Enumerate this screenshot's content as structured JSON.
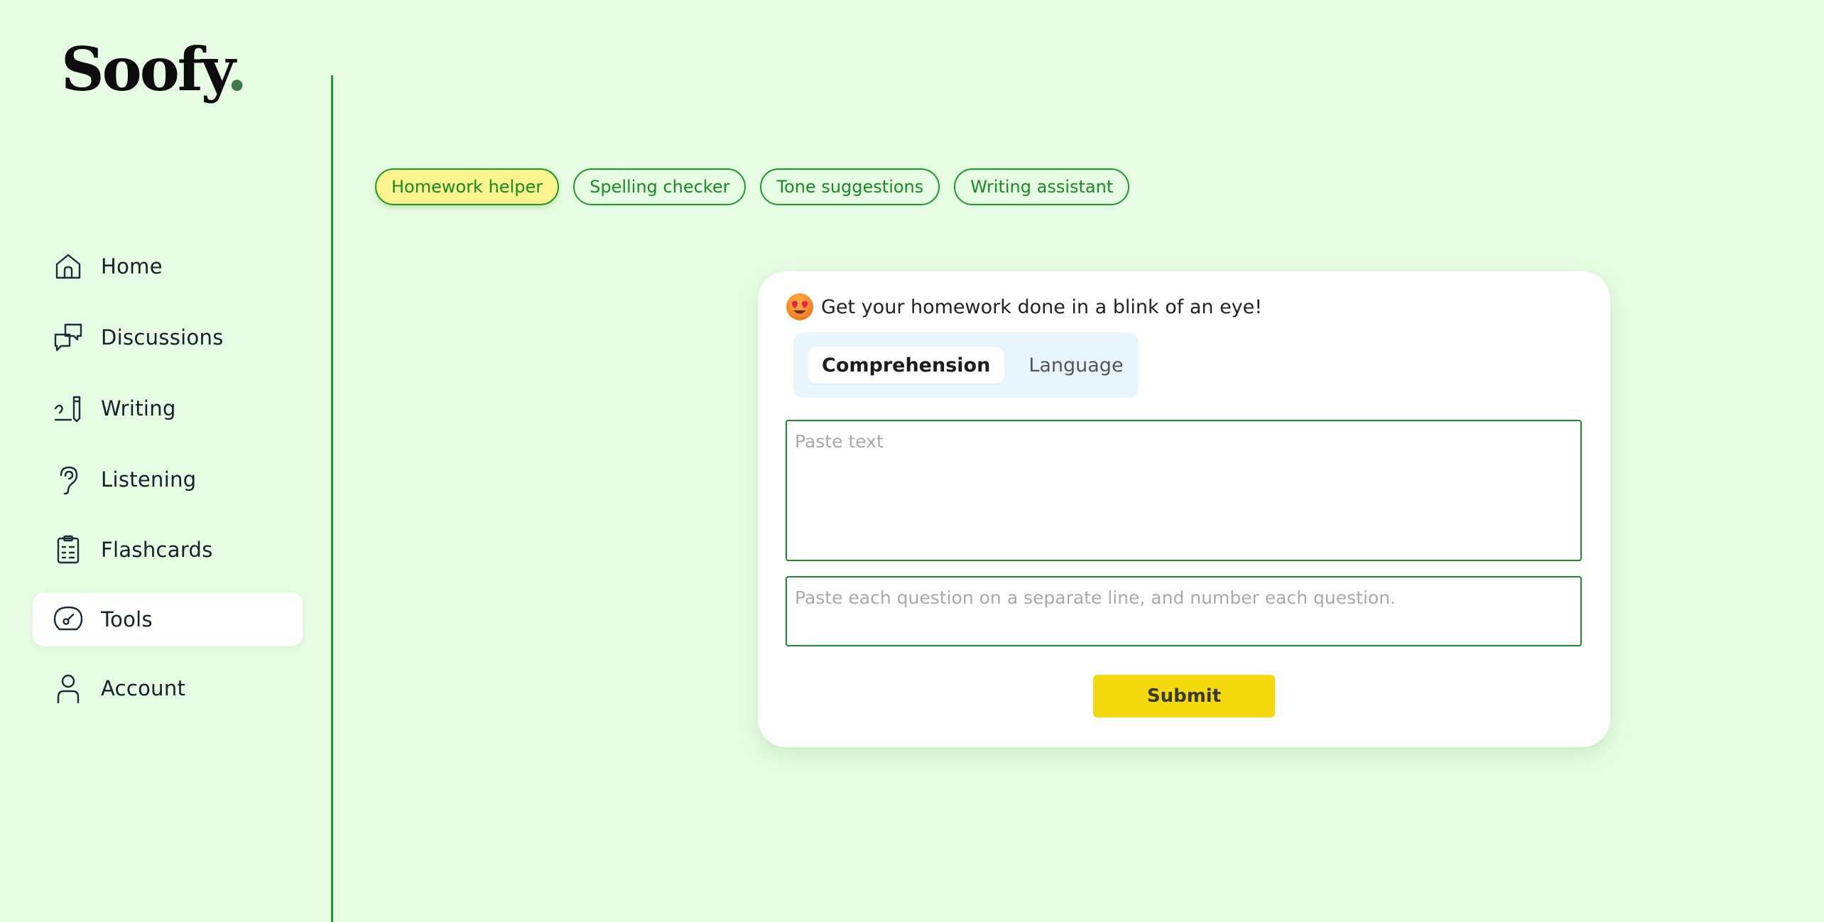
{
  "brand": {
    "name": "Soofy",
    "dot": ".",
    "dot_color": "#3f7a4f"
  },
  "sidebar": {
    "items": [
      {
        "label": "Home",
        "icon": "home-icon",
        "active": false
      },
      {
        "label": "Discussions",
        "icon": "chat-bubbles-icon",
        "active": false
      },
      {
        "label": "Writing",
        "icon": "pen-writing-icon",
        "active": false
      },
      {
        "label": "Listening",
        "icon": "ear-icon",
        "active": false
      },
      {
        "label": "Flashcards",
        "icon": "clipboard-list-icon",
        "active": false
      },
      {
        "label": "Tools",
        "icon": "gauge-icon",
        "active": true
      },
      {
        "label": "Account",
        "icon": "user-icon",
        "active": false
      }
    ]
  },
  "tools": {
    "chips": [
      {
        "label": "Homework helper",
        "active": true
      },
      {
        "label": "Spelling checker",
        "active": false
      },
      {
        "label": "Tone suggestions",
        "active": false
      },
      {
        "label": "Writing assistant",
        "active": false
      }
    ]
  },
  "card": {
    "emoji": "star-struck-face-icon",
    "title": "Get your homework done in a blink of an eye!",
    "modes": [
      {
        "label": "Comprehension",
        "active": true
      },
      {
        "label": "Language",
        "active": false
      }
    ],
    "text_field": {
      "value": "",
      "placeholder": "Paste text"
    },
    "questions_field": {
      "value": "",
      "placeholder": "Paste each question on a separate line, and number each question."
    },
    "submit_label": "Submit"
  },
  "colors": {
    "background": "#e7fde3",
    "accent_green": "#1a9a2a",
    "active_chip": "#fbf38d",
    "submit": "#f4d90f",
    "segmented_bg": "#e6f6fc"
  }
}
